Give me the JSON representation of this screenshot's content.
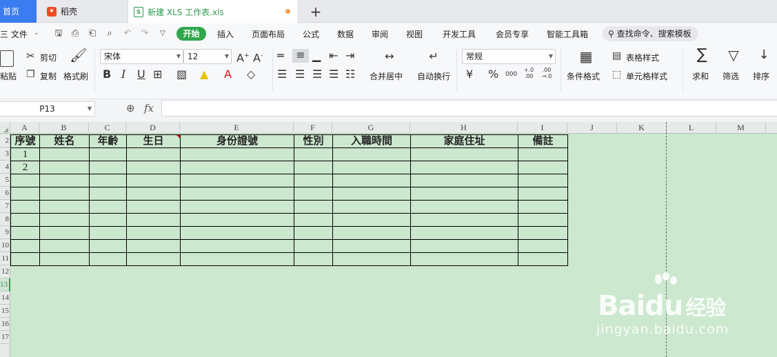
{
  "tabs": {
    "home": "首页",
    "docer": "稻壳",
    "file": "新建 XLS 工作表.xls",
    "add": "+"
  },
  "menu": {
    "file": "三 文件",
    "items": [
      "开始",
      "插入",
      "页面布局",
      "公式",
      "数据",
      "审阅",
      "视图",
      "开发工具",
      "会员专享",
      "智能工具箱"
    ],
    "search": "查找命令、搜索模板"
  },
  "ribbon": {
    "paste": "粘贴",
    "cut": "剪切",
    "copy": "复制",
    "format_painter": "格式刷",
    "font_name": "宋体",
    "font_size": "12",
    "bold": "B",
    "italic": "I",
    "underline": "U",
    "merge_center": "合并居中",
    "wrap_text": "自动换行",
    "number_format": "常规",
    "currency": "¥",
    "percent": "%",
    "thousands": "000",
    "inc_decimal": "+.0 .00",
    "dec_decimal": ".00 →.0",
    "conditional_format": "条件格式",
    "table_style": "表格样式",
    "cell_style": "单元格样式",
    "sum": "求和",
    "filter": "筛选",
    "sort": "排序"
  },
  "formula_bar": {
    "cell_ref": "P13",
    "fx": "fx",
    "value": ""
  },
  "sheet": {
    "columns": [
      "A",
      "B",
      "C",
      "D",
      "E",
      "F",
      "G",
      "H",
      "I",
      "J",
      "K",
      "L",
      "M"
    ],
    "row_numbers": [
      "2",
      "3",
      "4",
      "5",
      "6",
      "7",
      "8",
      "9",
      "10",
      "11",
      "12",
      "13",
      "14",
      "15",
      "16",
      "17"
    ],
    "active_row": "13",
    "table_headers": [
      "序號",
      "姓名",
      "年齡",
      "生日",
      "身份證號",
      "性別",
      "入職時間",
      "家庭住址",
      "備註"
    ],
    "table_rows": [
      [
        "1",
        "",
        "",
        "",
        "",
        "",
        "",
        "",
        ""
      ],
      [
        "2",
        "",
        "",
        "",
        "",
        "",
        "",
        "",
        ""
      ],
      [
        "",
        "",
        "",
        "",
        "",
        "",
        "",
        "",
        ""
      ],
      [
        "",
        "",
        "",
        "",
        "",
        "",
        "",
        "",
        ""
      ],
      [
        "",
        "",
        "",
        "",
        "",
        "",
        "",
        "",
        ""
      ],
      [
        "",
        "",
        "",
        "",
        "",
        "",
        "",
        "",
        ""
      ],
      [
        "",
        "",
        "",
        "",
        "",
        "",
        "",
        "",
        ""
      ],
      [
        "",
        "",
        "",
        "",
        "",
        "",
        "",
        "",
        ""
      ],
      [
        "",
        "",
        "",
        "",
        "",
        "",
        "",
        "",
        ""
      ]
    ]
  },
  "watermark": {
    "brand": "Bai",
    "brand_suffix": "du",
    "brand_cn": "经验",
    "url": "jingyan.baidu.com"
  },
  "colors": {
    "sheet_bg": "#cce8cf",
    "accent_green": "#2fa64a",
    "home_tab_blue": "#3b7cf0"
  }
}
